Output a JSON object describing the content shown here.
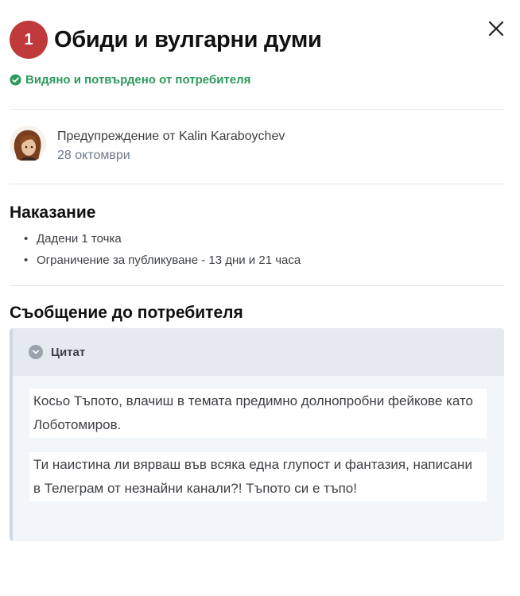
{
  "header": {
    "badge_number": "1",
    "title": "Обиди и вулгарни думи"
  },
  "status": {
    "text": "Видяно и потвърдено от потребителя",
    "color": "#2e9a5c"
  },
  "warning": {
    "by_text": "Предупреждение от Kalin Karaboychev",
    "date": "28 октомври"
  },
  "punishment": {
    "heading": "Наказание",
    "items": [
      "Дадени 1 точка",
      "Ограничение за публикуване - 13 дни и 21 часа"
    ]
  },
  "message": {
    "heading": "Съобщение до потребителя",
    "quote_label": "Цитат",
    "paragraphs": [
      "Косьо Тъпото, влачиш в темата предимно долнопробни фейкове като Лоботомиров.",
      "Ти наистина ли вярваш във всяка една глупост и фантазия, написани в Телеграм от незнайни канали?! Тъпото си е тъпо!"
    ]
  },
  "icons": {
    "close": "close-icon",
    "status": "check-circle-icon",
    "quote": "chevron-down-icon"
  },
  "colors": {
    "badge": "#c0393b",
    "date": "#6c7a8e",
    "quote_border": "#cfd8e3"
  }
}
